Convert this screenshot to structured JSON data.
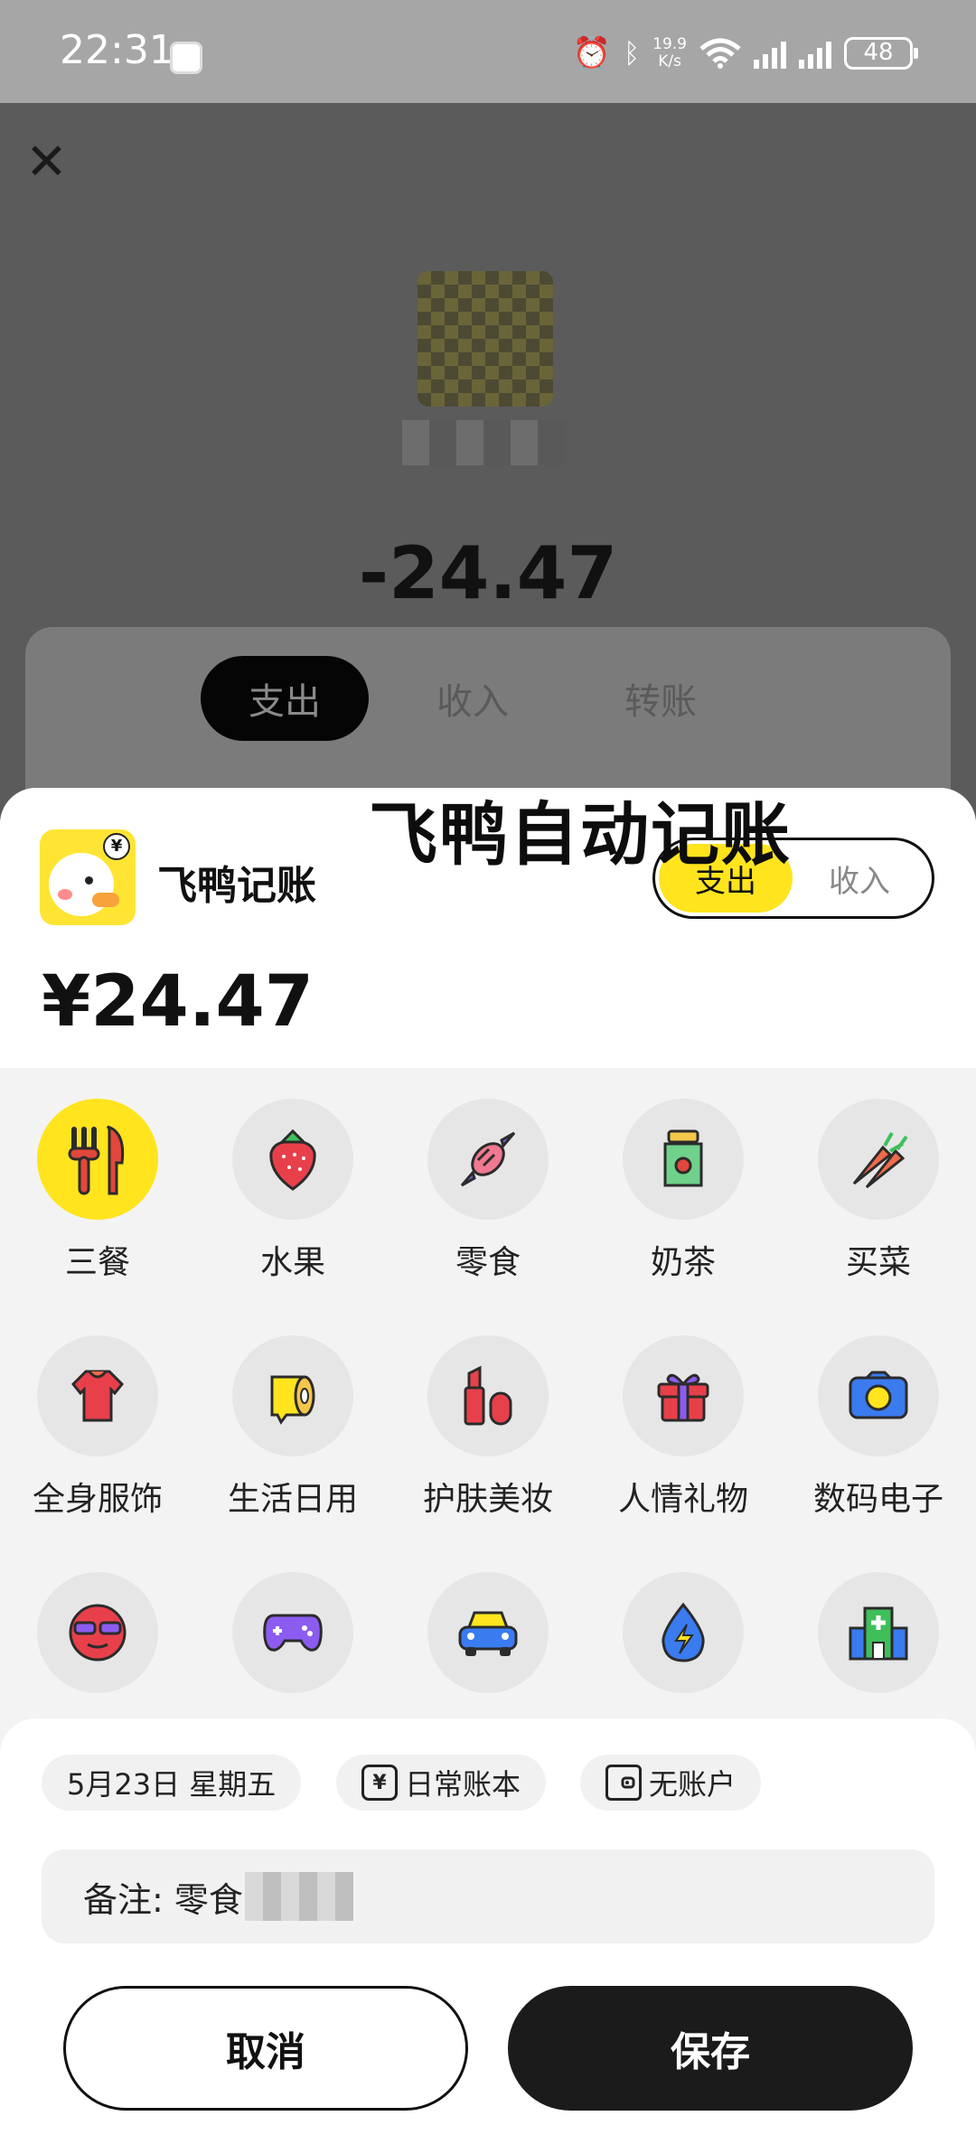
{
  "status_bar": {
    "time": "22:31",
    "net_speed_value": "19.9",
    "net_speed_unit": "K/s",
    "battery": "48",
    "icons": [
      "alarm-icon",
      "bluetooth-icon",
      "wifi-icon",
      "signal-icon",
      "signal-icon",
      "battery-icon"
    ]
  },
  "background": {
    "amount": "-24.47",
    "tabs": [
      "支出",
      "收入",
      "转账"
    ],
    "active_tab": "支出"
  },
  "overlay_title": "飞鸭自动记账",
  "sheet": {
    "app_name": "飞鸭记账",
    "type_options": [
      "支出",
      "收入"
    ],
    "selected_type": "支出",
    "amount": "¥24.47",
    "categories": [
      {
        "label": "三餐",
        "icon": "utensils-icon",
        "selected": true
      },
      {
        "label": "水果",
        "icon": "strawberry-icon"
      },
      {
        "label": "零食",
        "icon": "candy-icon"
      },
      {
        "label": "奶茶",
        "icon": "milk-tea-icon"
      },
      {
        "label": "买菜",
        "icon": "vegetable-icon"
      },
      {
        "label": "全身服饰",
        "icon": "clothing-icon"
      },
      {
        "label": "生活日用",
        "icon": "tissue-roll-icon"
      },
      {
        "label": "护肤美妆",
        "icon": "lipstick-icon"
      },
      {
        "label": "人情礼物",
        "icon": "gift-icon"
      },
      {
        "label": "数码电子",
        "icon": "camera-icon"
      },
      {
        "label": "",
        "icon": "sunglasses-face-icon"
      },
      {
        "label": "",
        "icon": "gamepad-icon"
      },
      {
        "label": "",
        "icon": "car-icon"
      },
      {
        "label": "",
        "icon": "water-electric-icon"
      },
      {
        "label": "",
        "icon": "hospital-icon"
      }
    ]
  },
  "bottom": {
    "date_chip": "5月23日 星期五",
    "ledger_chip": "日常账本",
    "ledger_icon_glyph": "¥",
    "account_chip": "无账户",
    "note": "备注: 零食",
    "cancel_label": "取消",
    "save_label": "保存"
  },
  "colors": {
    "accent_yellow": "#FFE41E",
    "dark": "#1B1B1B",
    "sheet_bg": "#F3F3F3"
  }
}
